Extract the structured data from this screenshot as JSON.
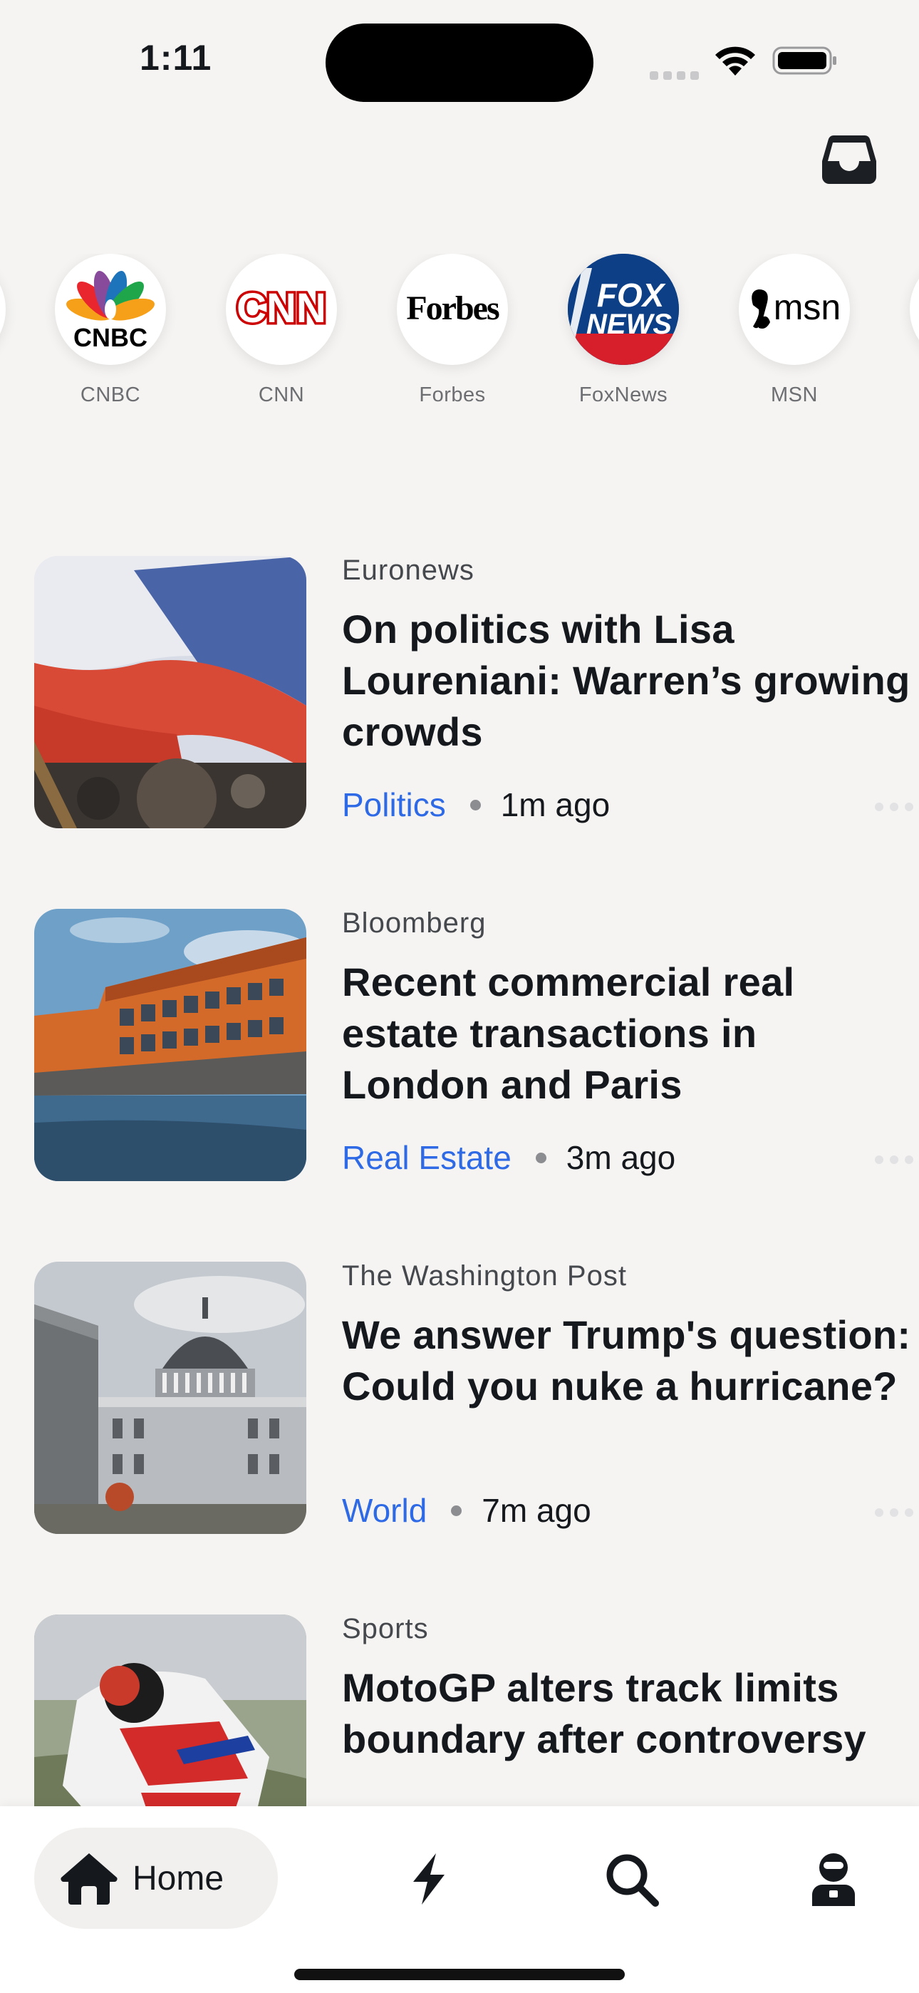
{
  "status_bar": {
    "time": "1:11"
  },
  "header": {
    "inbox_icon": "inbox-icon"
  },
  "sources": [
    {
      "name": "CNBC"
    },
    {
      "name": "CNN"
    },
    {
      "name": "Forbes"
    },
    {
      "name": "FoxNews"
    },
    {
      "name": "MSN"
    }
  ],
  "articles": [
    {
      "source": "Euronews",
      "title": "On politics with Lisa Loureniani: Warren’s growing crowds",
      "category": "Politics",
      "time": "1m ago"
    },
    {
      "source": "Bloomberg",
      "title": "Recent commercial real estate transactions in London and Paris",
      "category": "Real Estate",
      "time": "3m ago"
    },
    {
      "source": "The Washington Post",
      "title": "We answer Trump's question: Could you nuke a hurricane?",
      "category": "World",
      "time": "7m ago"
    },
    {
      "source": "Sports",
      "title": "MotoGP alters track limits boundary after controversy"
    }
  ],
  "tabbar": {
    "home_label": "Home",
    "icons": [
      "home-icon",
      "flash-icon",
      "search-icon",
      "profile-icon"
    ]
  },
  "colors": {
    "accent": "#2f6ae6",
    "background": "#f5f4f2",
    "text": "#15191e"
  }
}
